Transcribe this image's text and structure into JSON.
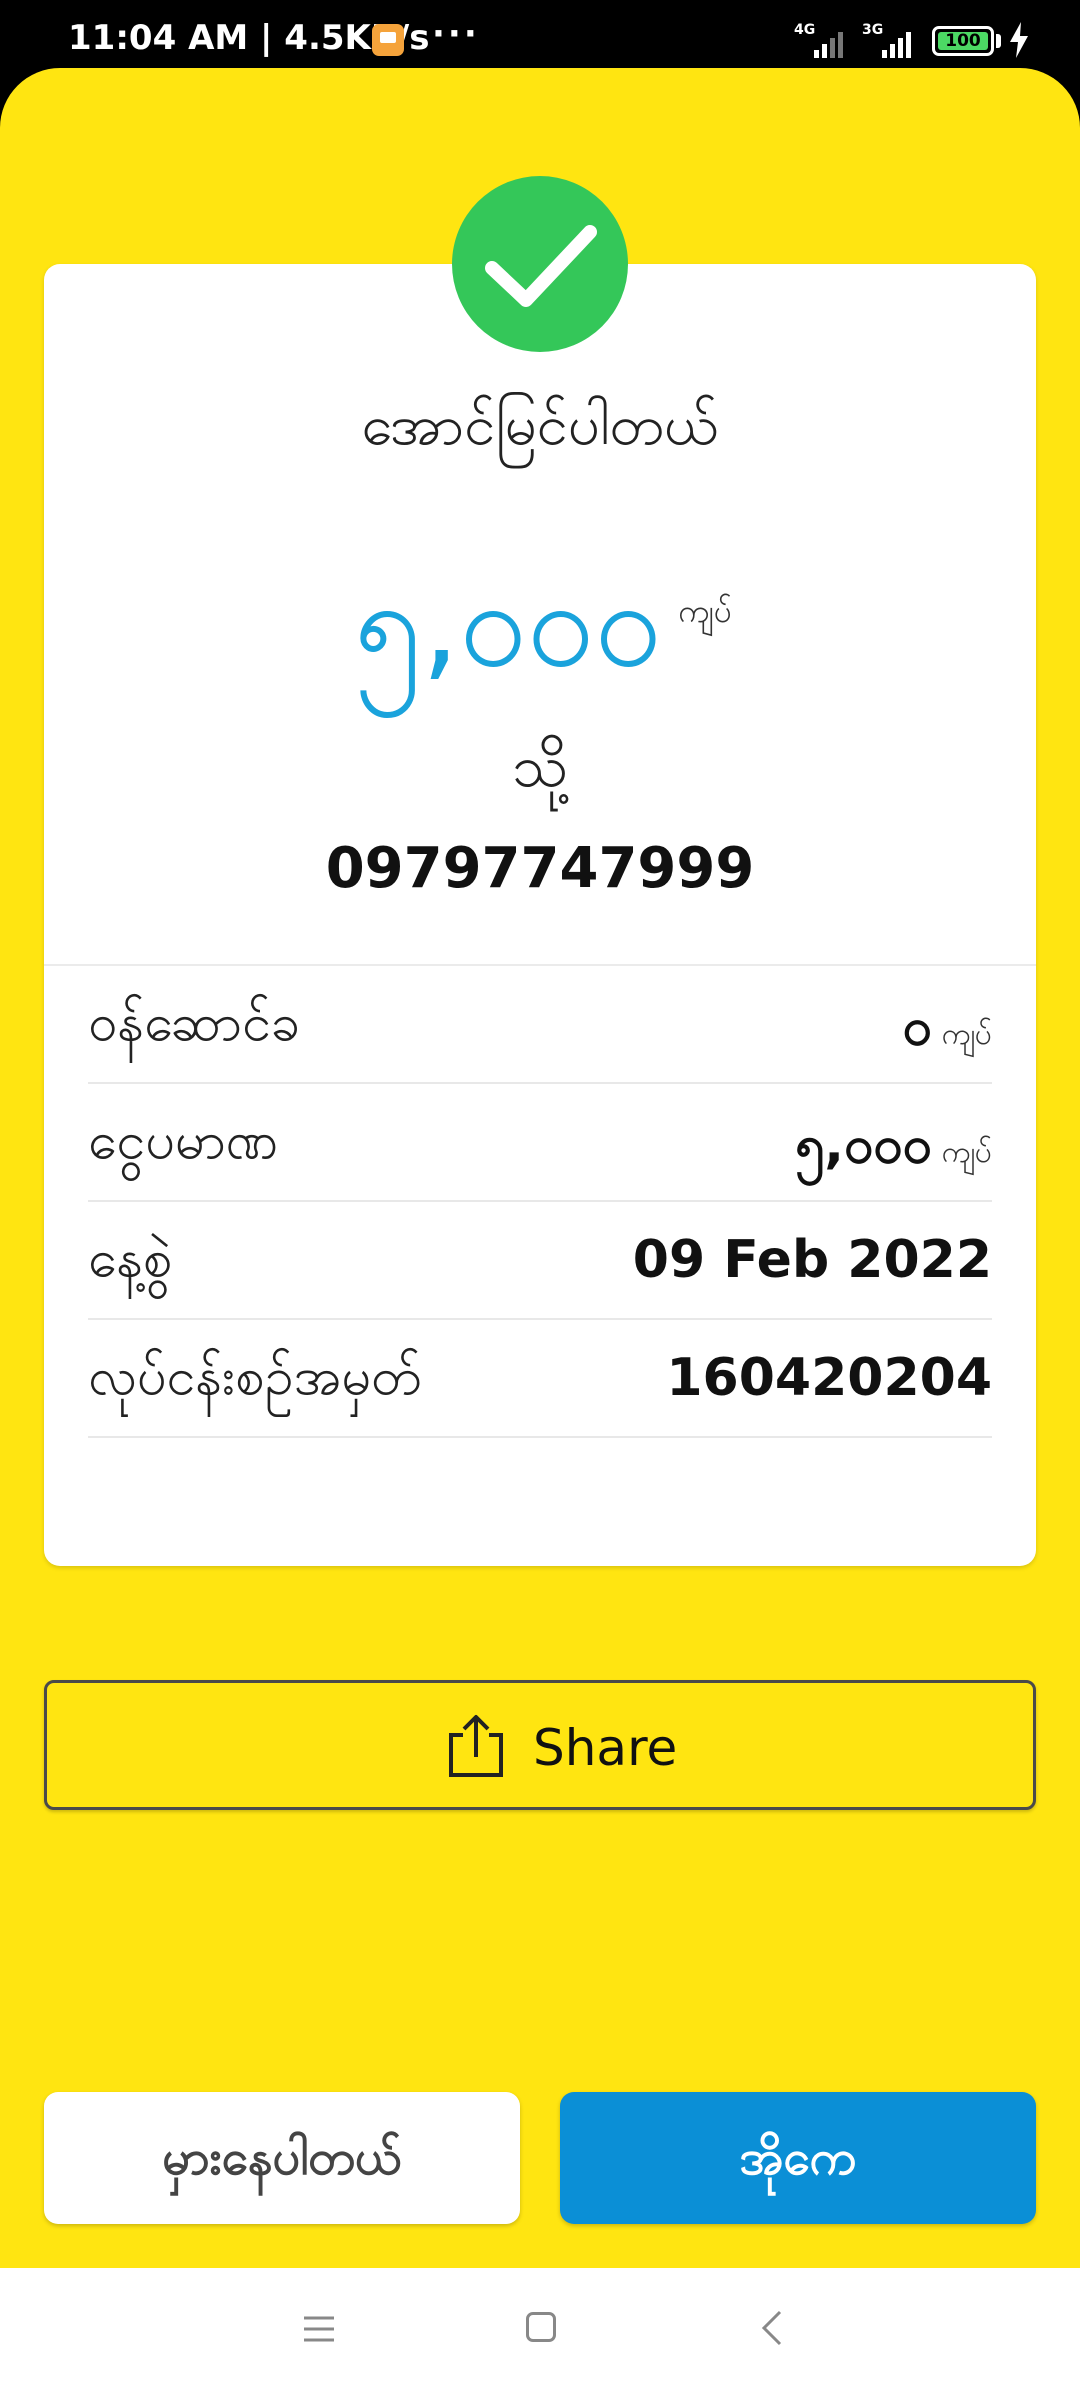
{
  "status_bar": {
    "time_speed": "11:04 AM | 4.5KB/s",
    "more": "···",
    "network1": "4G",
    "network2": "3G",
    "battery": "100"
  },
  "receipt": {
    "title": "အောင်မြင်ပါတယ်",
    "amount": "၅,၀၀၀",
    "amount_unit": "ကျပ်",
    "to_label": "သို့",
    "phone": "09797747999",
    "details": [
      {
        "label": "ဝန်ဆောင်ခ",
        "value": "၀",
        "unit": "ကျပ်"
      },
      {
        "label": "ငွေပမာဏ",
        "value": "၅,၀၀၀",
        "unit": "ကျပ်"
      },
      {
        "label": "နေ့စွဲ",
        "value": "09 Feb 2022",
        "unit": ""
      },
      {
        "label": "လုပ်ငန်းစဉ်အမှတ်",
        "value": "160420204",
        "unit": ""
      }
    ]
  },
  "share_button": {
    "label": "Share",
    "icon": "share-icon"
  },
  "actions": {
    "wrong_label": "မှားနေပါတယ်",
    "ok_label": "အိုကေ"
  },
  "colors": {
    "background": "#ffe511",
    "success": "#34c759",
    "amount": "#1aa3dc",
    "primary_button": "#0b8fd6"
  }
}
